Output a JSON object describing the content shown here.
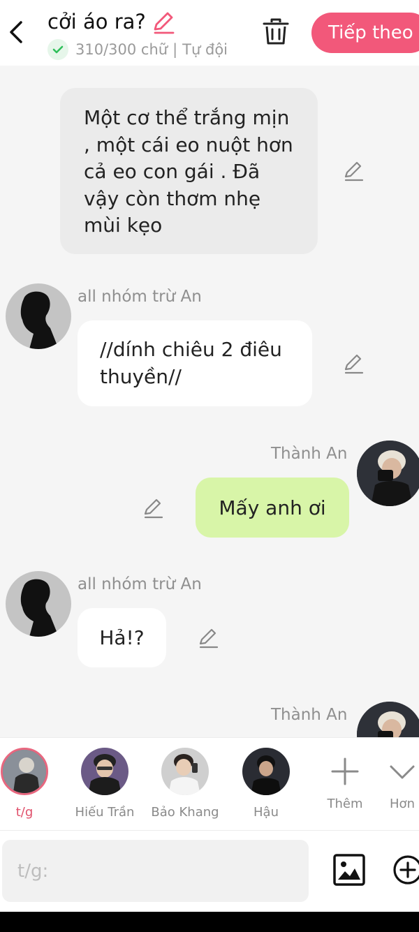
{
  "header": {
    "title": "cởi áo ra?",
    "word_count": "310/300 chữ",
    "separator": "|",
    "mode": "Tự đội",
    "next_label": "Tiếp theo"
  },
  "chat": {
    "narration": "Một cơ thể trắng mịn , một cái eo nuột hơn cả eo con gái . Đã vậy còn thơm nhẹ mùi kẹo",
    "messages": [
      {
        "sender": "all nhóm trừ An",
        "text": "//dính chiêu 2 điêu thuyền//"
      },
      {
        "sender": "Thành An",
        "text": "Mấy anh ơi"
      },
      {
        "sender": "all nhóm trừ An",
        "text": "Hả!?"
      },
      {
        "sender": "Thành An",
        "text": ""
      }
    ]
  },
  "characters": [
    {
      "label": "t/g",
      "selected": true
    },
    {
      "label": "Hiếu Trần"
    },
    {
      "label": "Bảo Khang"
    },
    {
      "label": "Hậu"
    },
    {
      "label": "Thêm"
    },
    {
      "label": "Hơn"
    }
  ],
  "input": {
    "placeholder": "t/g:"
  },
  "colors": {
    "accent": "#f2587a",
    "own_bubble": "#d8f5a8",
    "narration_bubble": "#ebebeb",
    "verified": "#2fbf5a"
  }
}
